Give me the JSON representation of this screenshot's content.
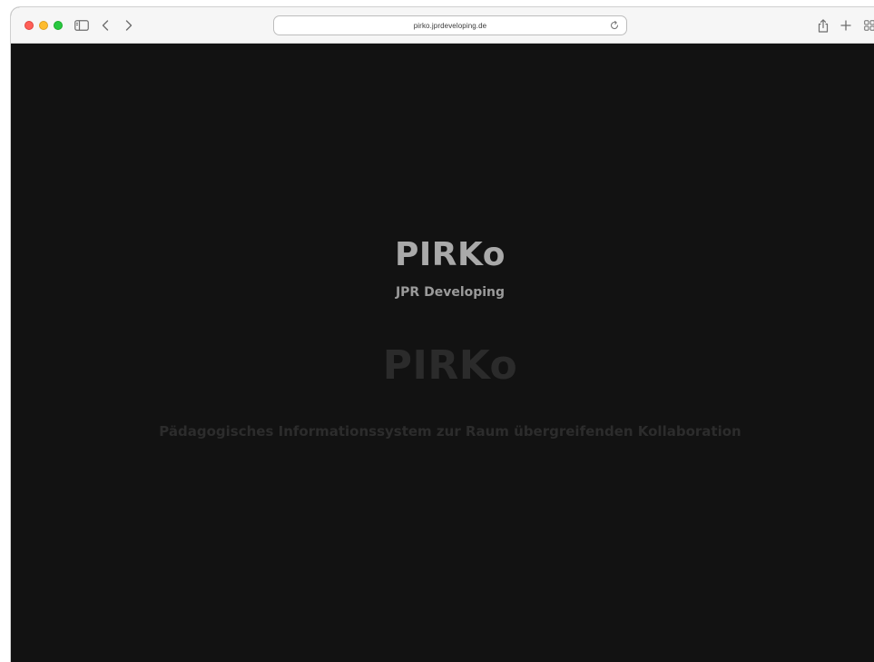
{
  "browser": {
    "url": "pirko.jprdeveloping.de",
    "icons": [
      "sidebar-icon",
      "back-icon",
      "forward-icon",
      "reload-icon",
      "share-icon",
      "new-tab-icon",
      "tab-overview-icon"
    ]
  },
  "page": {
    "title": "PIRKo",
    "subtitle": "JPR Developing",
    "ghost_title": "PIRKo",
    "tagline": "Pädagogisches Informationssystem zur Raum übergreifenden Kollaboration"
  },
  "colors": {
    "background": "#121212",
    "title": "#a9a9a9",
    "ghost_text": "#2b2b2b"
  }
}
